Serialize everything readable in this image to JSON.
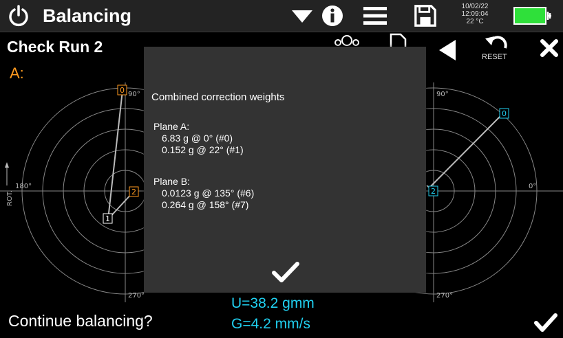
{
  "topbar": {
    "title": "Balancing",
    "date": "10/02/22",
    "time": "12:09:04",
    "temperature": "22 °C",
    "battery_color": "#2fe03a"
  },
  "header": {
    "run_title": "Check Run 2",
    "reset_label": "RESET"
  },
  "plane_a_label": "A:",
  "plot_a": {
    "label_90": "90°",
    "label_180": "180°",
    "label_270": "270°",
    "rot_label": "ROT.",
    "marker_0": "0",
    "marker_1": "1",
    "marker_2": "2",
    "color": "#ff9a1f"
  },
  "plot_b": {
    "label_90": "90°",
    "label_0": "0°",
    "label_270": "270°",
    "marker_0": "0",
    "marker_2": "2",
    "color": "#20d0f0"
  },
  "dialog": {
    "title": "Combined correction weights",
    "plane_a": {
      "name": "Plane A:",
      "weights": [
        "6.83 g @ 0° (#0)",
        "0.152 g @ 22° (#1)"
      ]
    },
    "plane_b": {
      "name": "Plane B:",
      "weights": [
        "0.0123 g @ 135° (#6)",
        "0.264 g @ 158° (#7)"
      ]
    }
  },
  "footer": {
    "prompt": "Continue balancing?",
    "unbalance": "U=38.2 gmm",
    "vibration": "G=4.2 mm/s"
  },
  "icons": [
    "power-icon",
    "dropdown-icon",
    "info-icon",
    "menu-icon",
    "save-icon",
    "group-icon",
    "document-icon",
    "back-icon",
    "reset-icon",
    "close-icon",
    "checkmark-icon"
  ]
}
